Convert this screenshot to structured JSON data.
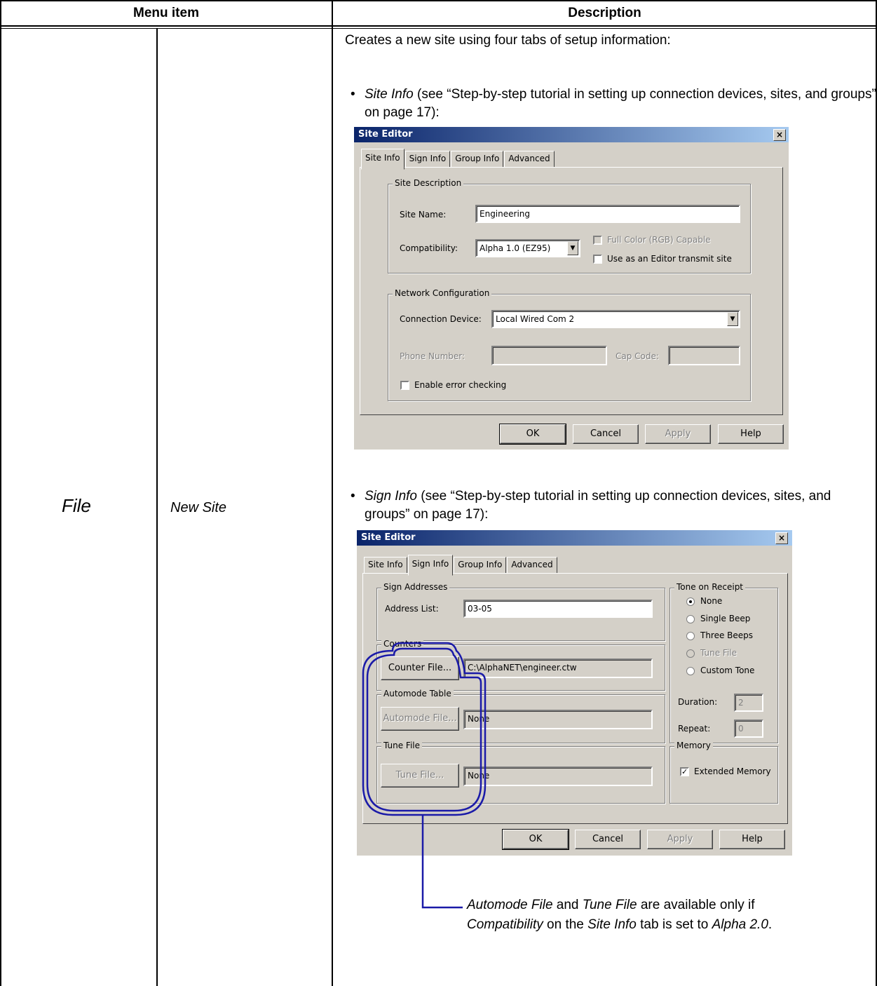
{
  "table": {
    "header_menu_item": "Menu item",
    "header_description": "Description",
    "menu_main": "File",
    "menu_sub": "New Site"
  },
  "intro": "Creates a new site using four tabs of setup information:",
  "bullet1": {
    "name": "Site Info",
    "text": " (see “Step-by-step tutorial in setting up connection devices, sites, and groups” on page 17):"
  },
  "bullet2": {
    "name": "Sign Info",
    "text": " (see “Step-by-step tutorial in setting up connection devices, sites, and groups” on page 17):"
  },
  "dialog1": {
    "title": "Site Editor",
    "close": "×",
    "tabs": [
      "Site Info",
      "Sign Info",
      "Group Info",
      "Advanced"
    ],
    "group_site_description": "Site Description",
    "site_name_label": "Site Name:",
    "site_name_value": "Engineering",
    "compatibility_label": "Compatibility:",
    "compatibility_value": "Alpha 1.0 (EZ95)",
    "full_color_label": "Full Color (RGB) Capable",
    "use_editor_label": "Use as an Editor transmit site",
    "group_network": "Network Configuration",
    "connection_label": "Connection Device:",
    "connection_value": "Local Wired Com 2",
    "phone_label": "Phone Number:",
    "cap_label": "Cap Code:",
    "error_check_label": "Enable error checking",
    "ok": "OK",
    "cancel": "Cancel",
    "apply": "Apply",
    "help": "Help"
  },
  "dialog2": {
    "title": "Site Editor",
    "close": "×",
    "tabs": [
      "Site Info",
      "Sign Info",
      "Group Info",
      "Advanced"
    ],
    "group_addresses": "Sign Addresses",
    "address_label": "Address List:",
    "address_value": "03-05",
    "group_counters": "Counters",
    "counter_btn": "Counter File...",
    "counter_value": "C:\\AlphaNET\\engineer.ctw",
    "group_automode": "Automode Table",
    "automode_btn": "Automode File...",
    "automode_value": "None",
    "group_tune": "Tune File",
    "tune_btn": "Tune File...",
    "tune_value": "None",
    "group_tone": "Tone on Receipt",
    "tone_none": "None",
    "tone_single": "Single Beep",
    "tone_three": "Three Beeps",
    "tone_tune": "Tune File",
    "tone_custom": "Custom Tone",
    "duration_label": "Duration:",
    "duration_value": "2",
    "repeat_label": "Repeat:",
    "repeat_value": "0",
    "group_memory": "Memory",
    "memory_label": "Extended Memory",
    "checkmark": "✓",
    "ok": "OK",
    "cancel": "Cancel",
    "apply": "Apply",
    "help": "Help"
  },
  "note": {
    "p1": "Automode File",
    "p2": " and ",
    "p3": "Tune File",
    "p4": " are available only if ",
    "p5": "Compatibility",
    "p6": " on the ",
    "p7": "Site Info",
    "p8": " tab is set to ",
    "p9": "Alpha 2.0",
    "p10": "."
  },
  "colors": {
    "callout": "#1a1aa8",
    "dialog_face": "#d4d0c8",
    "title_start": "#0a246a",
    "title_end": "#a6caf0"
  }
}
